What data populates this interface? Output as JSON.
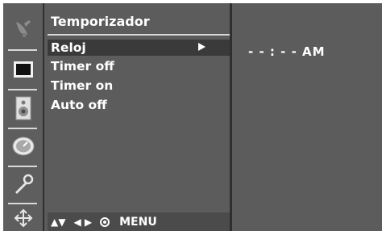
{
  "menu": {
    "title": "Temporizador",
    "items": [
      {
        "label": "Reloj",
        "selected": true
      },
      {
        "label": "Timer off",
        "selected": false
      },
      {
        "label": "Timer on",
        "selected": false
      },
      {
        "label": "Auto off",
        "selected": false
      }
    ],
    "footer": {
      "updown": "▲▼",
      "leftright": "◀ ▶",
      "menu": "MENU"
    }
  },
  "sidebar": {
    "icons": [
      "satellite-dish-icon",
      "picture-icon",
      "speaker-icon",
      "clock-icon",
      "wrench-icon",
      "settings-arrows-icon"
    ]
  },
  "clock_panel": {
    "value": "- - : - - AM"
  },
  "colors": {
    "panel": "#5c5c5c",
    "selected": "#3a3a3a",
    "text": "#ffffff",
    "separator": "#d8d8d8"
  }
}
